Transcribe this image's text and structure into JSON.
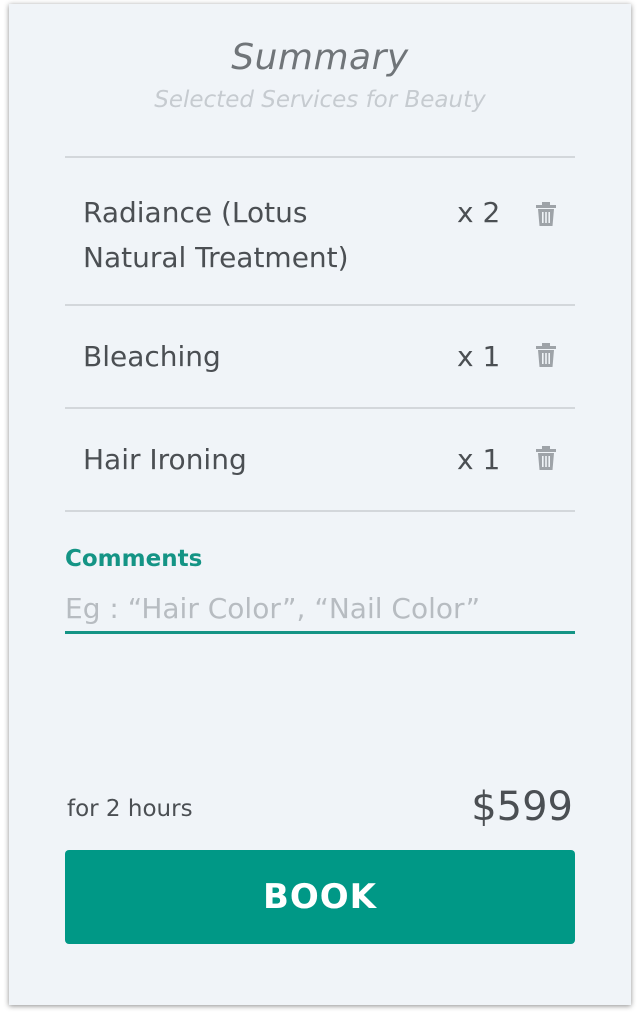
{
  "header": {
    "title": "Summary",
    "subtitle": "Selected Services for Beauty"
  },
  "services": [
    {
      "name": "Radiance (Lotus Natural Treatment)",
      "quantity": "x 2",
      "remove_icon": "trash-icon"
    },
    {
      "name": "Bleaching",
      "quantity": "x 1",
      "remove_icon": "trash-icon"
    },
    {
      "name": "Hair Ironing",
      "quantity": "x 1",
      "remove_icon": "trash-icon"
    }
  ],
  "comments": {
    "label": "Comments",
    "value": "",
    "placeholder": "Eg : “Hair Color”, “Nail Color”"
  },
  "footer": {
    "duration": "for 2 hours",
    "price": "$599"
  },
  "book_button": {
    "label": "BOOK"
  },
  "colors": {
    "accent": "#009886",
    "background": "#f0f4f8",
    "text": "#4b4f53",
    "divider": "#d3d7db"
  }
}
